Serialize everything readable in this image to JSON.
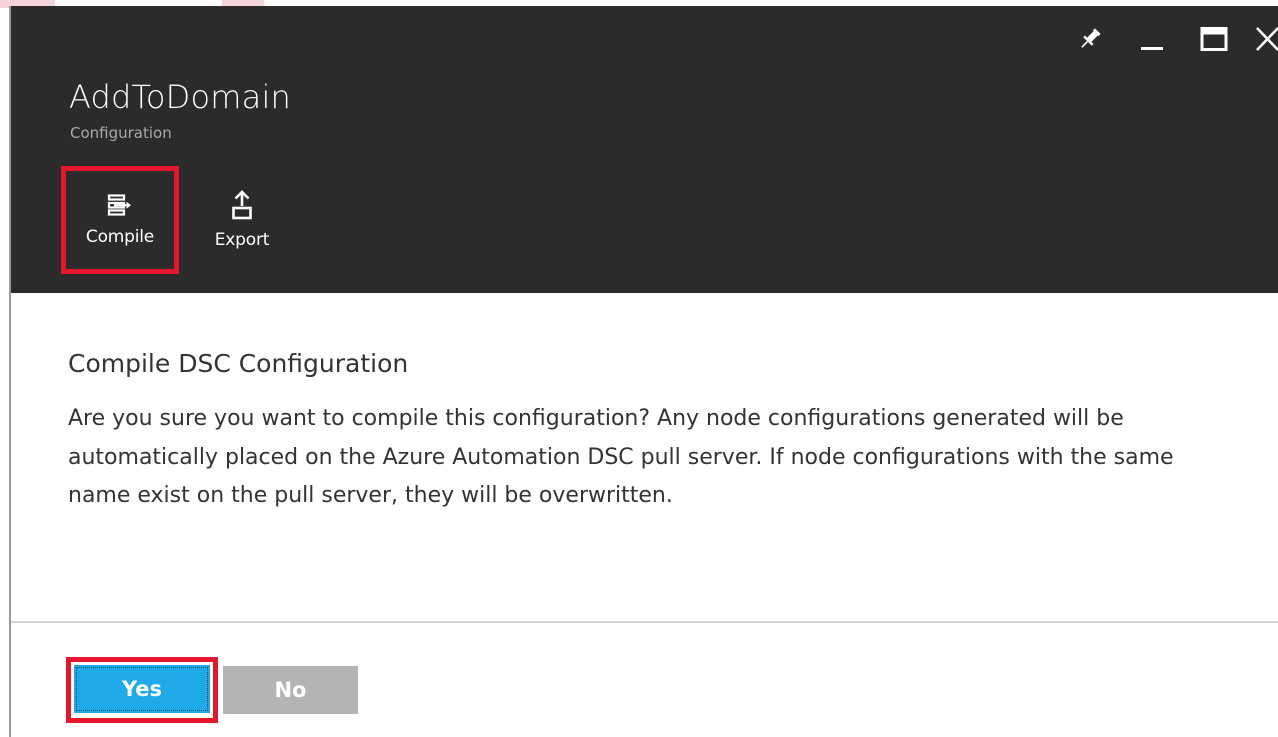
{
  "window": {
    "title": "AddToDomain",
    "subtitle": "Configuration",
    "controls": [
      "pin-icon",
      "minimize-icon",
      "maximize-icon",
      "close-icon"
    ]
  },
  "commands": {
    "compile_label": "Compile",
    "export_label": "Export"
  },
  "prompt": {
    "title": "Compile DSC Configuration",
    "message": "Are you sure you want to compile this configuration? Any node configurations generated will be automatically placed on the Azure Automation DSC pull server. If node configurations with the same name exist on the pull server, they will be overwritten."
  },
  "actions": {
    "yes_label": "Yes",
    "no_label": "No"
  },
  "colors": {
    "header_background": "#2b2b2b",
    "highlight_border": "#e3162b",
    "yes_button": "#1ea9e8",
    "no_button": "#b4b4b4"
  }
}
